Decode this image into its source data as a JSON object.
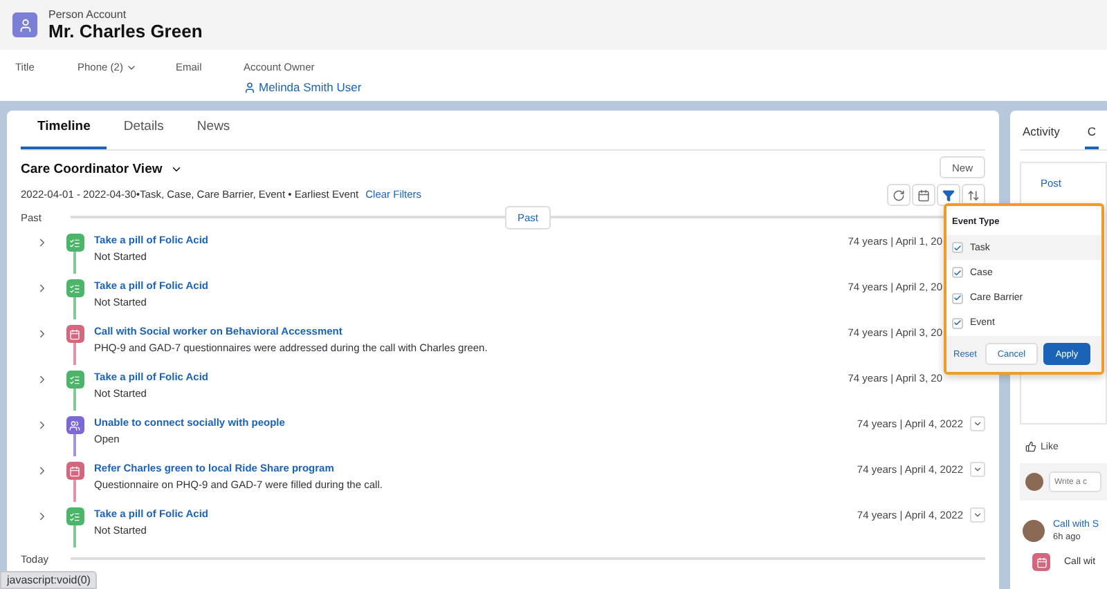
{
  "record": {
    "object": "Person Account",
    "name": "Mr. Charles Green",
    "fields": [
      {
        "label": "Title"
      },
      {
        "label": "Phone (2)",
        "dropdown": true
      },
      {
        "label": "Email"
      },
      {
        "label": "Account Owner",
        "value": "Melinda Smith User"
      }
    ]
  },
  "tabs": [
    {
      "label": "Timeline",
      "selected": true
    },
    {
      "label": "Details",
      "selected": false
    },
    {
      "label": "News",
      "selected": false
    }
  ],
  "view": {
    "title": "Care Coordinator View",
    "filter_summary": "2022-04-01 - 2022-04-30•Task, Case, Care Barrier, Event • Earliest Event",
    "clear_link": "Clear Filters",
    "new_button": "New"
  },
  "sections": [
    {
      "label": "Past",
      "marker": "Past"
    }
  ],
  "items": [
    {
      "kind": "task",
      "title": "Take a pill of Folic Acid",
      "subtitle": "Not Started",
      "date": "74 years | April 1, 20",
      "menu_visible": false
    },
    {
      "kind": "task",
      "title": "Take a pill of Folic Acid",
      "subtitle": "Not Started",
      "date": "74 years | April 2, 20",
      "menu_visible": false
    },
    {
      "kind": "event",
      "title": "Call with Social worker on Behavioral Accessment",
      "subtitle": "PHQ-9 and GAD-7 questionnaires were addressed during the call with Charles green.",
      "date": "74 years | April 3, 20",
      "menu_visible": false
    },
    {
      "kind": "task",
      "title": "Take a pill of Folic Acid",
      "subtitle": "Not Started",
      "date": "74 years | April 3, 20",
      "menu_visible": false
    },
    {
      "kind": "care_barrier",
      "title": "Unable to connect socially with people",
      "subtitle": "Open",
      "date": "74 years | April 4, 2022",
      "menu_visible": true
    },
    {
      "kind": "event",
      "title": "Refer Charles green to local Ride Share program",
      "subtitle": "Questionnaire on PHQ-9 and GAD-7 were filled during the call.",
      "date": "74 years | April 4, 2022",
      "menu_visible": true
    },
    {
      "kind": "task",
      "title": "Take a pill of Folic Acid",
      "subtitle": "Not Started",
      "date": "74 years | April 4, 2022",
      "menu_visible": true
    }
  ],
  "today_label": "Today",
  "filter_popup": {
    "title": "Event Type",
    "options": [
      {
        "label": "Task",
        "checked": true,
        "hovered": true
      },
      {
        "label": "Case",
        "checked": true,
        "hovered": false
      },
      {
        "label": "Care Barrier",
        "checked": true,
        "hovered": false
      },
      {
        "label": "Event",
        "checked": true,
        "hovered": false
      }
    ],
    "reset": "Reset",
    "cancel": "Cancel",
    "apply": "Apply"
  },
  "side": {
    "tabs": [
      {
        "label": "Activity",
        "selected": false
      },
      {
        "label": "C",
        "selected": true
      }
    ],
    "post_tab": "Post",
    "like": "Like",
    "comment_placeholder": "Write a c",
    "feed_title": "Call with S",
    "feed_time": "6h ago",
    "feed_item": "Call wit"
  },
  "status_url": "javascript:void(0)"
}
